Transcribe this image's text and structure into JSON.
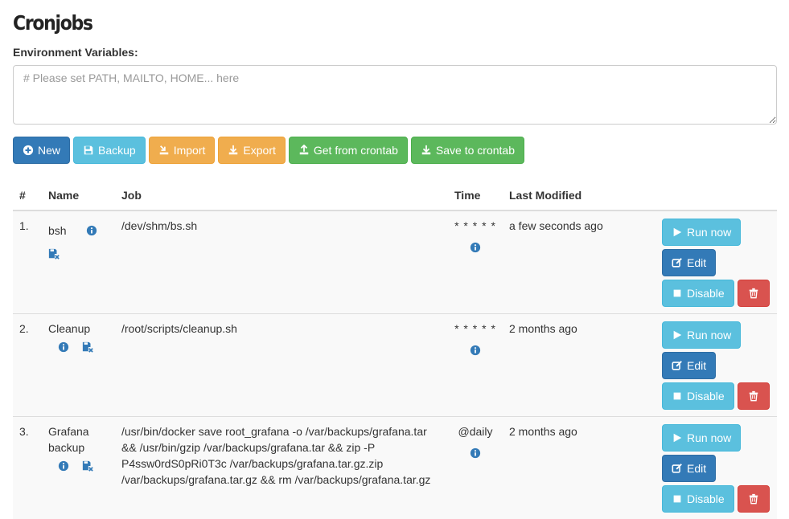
{
  "page": {
    "title": "Cronjobs"
  },
  "env": {
    "label": "Environment Variables:",
    "placeholder": "# Please set PATH, MAILTO, HOME... here"
  },
  "toolbar": {
    "new_label": "New",
    "backup_label": "Backup",
    "import_label": "Import",
    "export_label": "Export",
    "get_label": "Get from crontab",
    "save_label": "Save to crontab"
  },
  "table": {
    "headers": [
      "#",
      "Name",
      "Job",
      "Time",
      "Last Modified"
    ],
    "rows": [
      {
        "num": "1.",
        "name": "bsh",
        "job": "/dev/shm/bs.sh",
        "time": "* * * * *",
        "modified": "a few seconds ago"
      },
      {
        "num": "2.",
        "name": "Cleanup",
        "job": "/root/scripts/cleanup.sh",
        "time": "* * * * *",
        "modified": "2 months ago"
      },
      {
        "num": "3.",
        "name": "Grafana backup",
        "job": "/usr/bin/docker save root_grafana -o /var/backups/grafana.tar && /usr/bin/gzip /var/backups/grafana.tar && zip -P P4ssw0rdS0pRi0T3c /var/backups/grafana.tar.gz.zip /var/backups/grafana.tar.gz && rm /var/backups/grafana.tar.gz",
        "time": "@daily",
        "modified": "2 months ago"
      }
    ]
  },
  "actions": {
    "run_label": "Run now",
    "edit_label": "Edit",
    "disable_label": "Disable"
  },
  "icons": {
    "new": "plus-circle-icon",
    "backup": "floppy-icon",
    "import": "import-icon",
    "export": "download-icon",
    "get": "upload-icon",
    "save": "download-icon",
    "info": "info-circle-icon",
    "backup_remove": "floppy-remove-icon",
    "run": "play-icon",
    "edit": "edit-icon",
    "disable": "stop-icon",
    "delete": "trash-icon"
  },
  "colors": {
    "primary": "#337ab7",
    "info": "#5bc0de",
    "warning": "#f0ad4e",
    "success": "#5cb85c",
    "danger": "#d9534f"
  }
}
